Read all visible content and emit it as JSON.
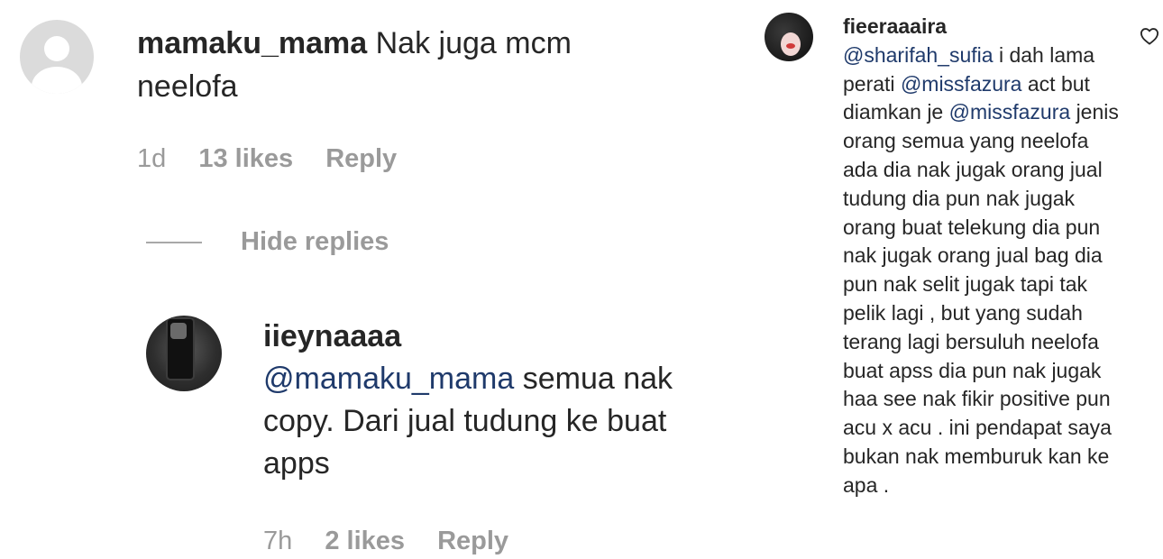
{
  "main_comment": {
    "username": "mamaku_mama",
    "text": "Nak juga mcm neelofa",
    "time": "1d",
    "likes": "13 likes",
    "reply_label": "Reply"
  },
  "hide_replies_label": "Hide replies",
  "reply_comment": {
    "username": "iieynaaaa",
    "mention": "@mamaku_mama",
    "text": "semua nak copy. Dari jual tudung ke buat apps",
    "time": "7h",
    "likes": "2 likes",
    "reply_label": "Reply"
  },
  "right_comment": {
    "username": "fieeraaaira",
    "mention1": "@sharifah_sufia",
    "text1": "i dah lama perati",
    "mention2": "@missfazura",
    "text2": "act but diamkan je",
    "mention3": "@missfazura",
    "text3": "jenis orang semua yang neelofa ada dia nak jugak orang jual tudung dia pun nak jugak orang buat telekung dia pun nak jugak orang jual bag dia pun nak selit jugak tapi tak pelik lagi , but yang sudah terang lagi bersuluh neelofa buat apss dia pun nak jugak haa see nak fikir positive pun acu x acu . ini pendapat saya bukan nak memburuk kan ke apa ."
  },
  "icons": {
    "default_avatar": "default-user-avatar-icon",
    "like": "heart-outline-icon"
  },
  "colors": {
    "text": "#262626",
    "meta": "#9a9a9a",
    "mention": "#1f3a6b",
    "default_avatar_bg": "#dbdbdb"
  }
}
